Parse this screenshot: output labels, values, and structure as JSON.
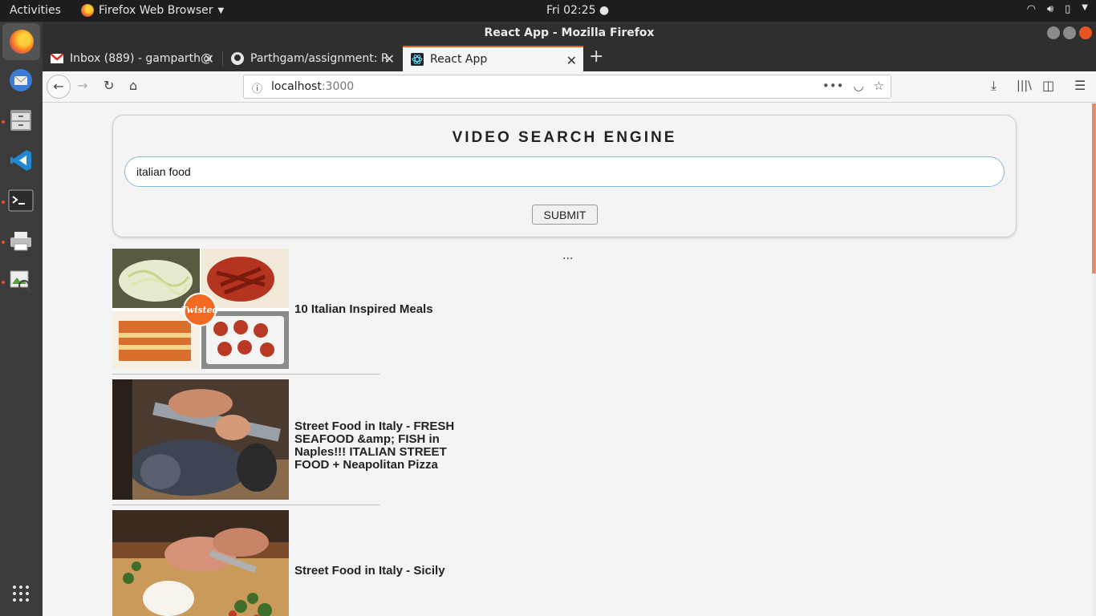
{
  "system": {
    "activities": "Activities",
    "app_name": "Firefox Web Browser",
    "clock": "Fri 02:25 ●"
  },
  "window": {
    "title": "React App - Mozilla Firefox"
  },
  "tabs": [
    {
      "label": "Inbox (889) - gamparth@",
      "icon": "gmail-icon"
    },
    {
      "label": "Parthgam/assignment: R",
      "icon": "github-icon"
    },
    {
      "label": "React App",
      "icon": "react-icon",
      "selected": true
    }
  ],
  "urlbar": {
    "host": "localhost",
    "port": ":3000"
  },
  "app": {
    "heading": "VIDEO SEARCH ENGINE",
    "search_value": "italian food",
    "submit_label": "SUBMIT",
    "loading_text": "..."
  },
  "videos": [
    {
      "title": "10 Italian Inspired Meals"
    },
    {
      "title": "Street Food in Italy - FRESH SEAFOOD &amp; FISH in Naples!!! ITALIAN STREET FOOD + Neapolitan Pizza"
    },
    {
      "title": "Street Food in Italy - Sicily"
    }
  ],
  "colors": {
    "accent_tab": "#e25c1e",
    "ubuntu_orange": "#e95420",
    "input_border": "#86b8d8"
  }
}
